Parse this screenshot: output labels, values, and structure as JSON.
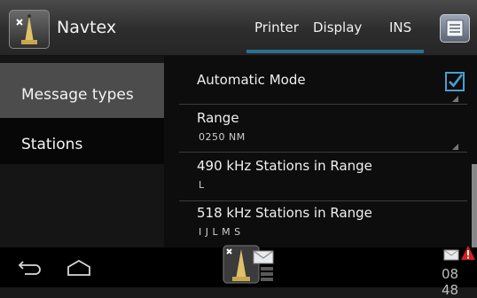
{
  "header": {
    "app_title": "Navtex",
    "tabs": [
      {
        "label": "Printer"
      },
      {
        "label": "Display"
      },
      {
        "label": "INS"
      }
    ]
  },
  "sidebar": {
    "items": [
      {
        "label": "Message types",
        "selected": false
      },
      {
        "label": "Stations",
        "selected": true
      }
    ]
  },
  "settings": [
    {
      "title": "Automatic Mode",
      "value": "",
      "checked": true
    },
    {
      "title": "Range",
      "value": "0250 NM"
    },
    {
      "title": "490 kHz Stations in Range",
      "value": "L"
    },
    {
      "title": "518 kHz Stations in Range",
      "value": "I J L M S"
    }
  ],
  "statusbar": {
    "time": "08 48"
  },
  "colors": {
    "accent": "#2c6f8d",
    "checkbox": "#4a9ed0",
    "alert": "#d42020"
  },
  "icons": {
    "app": "navtex-antenna-icon",
    "menu": "menu-icon",
    "back": "back-icon",
    "home": "home-icon",
    "notification_app": "navtex-notification-icon",
    "mail_status": "mail-icon",
    "alert_status": "alert-icon"
  }
}
